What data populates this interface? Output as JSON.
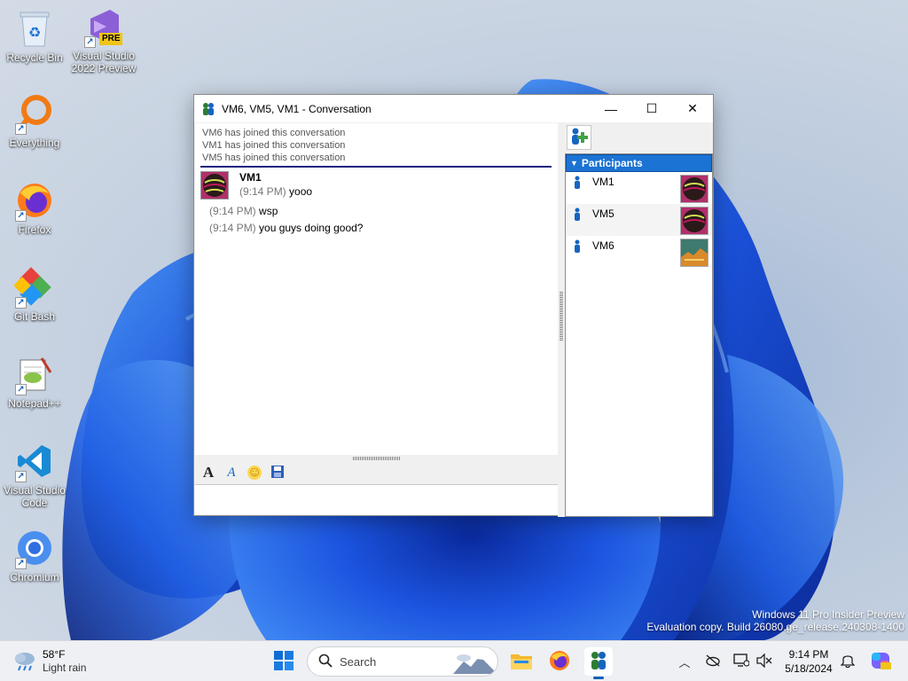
{
  "desktop": {
    "icons": [
      {
        "label": "Recycle Bin",
        "icon": "recycle-bin-icon"
      },
      {
        "label": "Visual Studio 2022 Preview",
        "icon": "visual-studio-icon",
        "badge": "PRE"
      },
      {
        "label": "Everything",
        "icon": "everything-search-icon"
      },
      {
        "label": "Firefox",
        "icon": "firefox-icon"
      },
      {
        "label": "Git Bash",
        "icon": "git-bash-icon"
      },
      {
        "label": "Notepad++",
        "icon": "notepad-plus-plus-icon"
      },
      {
        "label": "Visual Studio Code",
        "icon": "vscode-icon"
      },
      {
        "label": "Chromium",
        "icon": "chromium-icon"
      }
    ],
    "watermark": {
      "line1": "Windows 11 Pro Insider Preview",
      "line2": "Evaluation copy. Build 26080.ge_release.240308-1400"
    }
  },
  "window": {
    "title": "VM6, VM5, VM1 - Conversation",
    "controls": {
      "minimize": "—",
      "maximize": "☐",
      "close": "✕"
    },
    "system_messages": [
      "VM6 has joined this conversation",
      "VM1 has joined this conversation",
      "VM5 has joined this conversation"
    ],
    "conversation": {
      "sender": "VM1",
      "messages": [
        {
          "time": "(9:14 PM)",
          "text": "yooo"
        },
        {
          "time": "(9:14 PM)",
          "text": "wsp"
        },
        {
          "time": "(9:14 PM)",
          "text": "you guys doing good?"
        }
      ]
    },
    "format_toolbar": [
      {
        "name": "font-icon",
        "glyph": "A"
      },
      {
        "name": "font-color-icon",
        "glyph": "A"
      },
      {
        "name": "emoticon-icon",
        "glyph": "☺"
      },
      {
        "name": "save-icon",
        "glyph": "💾"
      }
    ],
    "input_value": "",
    "participants": {
      "header": "Participants",
      "list": [
        {
          "name": "VM1"
        },
        {
          "name": "VM5"
        },
        {
          "name": "VM6"
        }
      ]
    }
  },
  "taskbar": {
    "weather": {
      "temp": "58°F",
      "condition": "Light rain"
    },
    "search_placeholder": "Search",
    "clock": {
      "time": "9:14 PM",
      "date": "5/18/2024"
    },
    "accent": "#005fb8"
  }
}
